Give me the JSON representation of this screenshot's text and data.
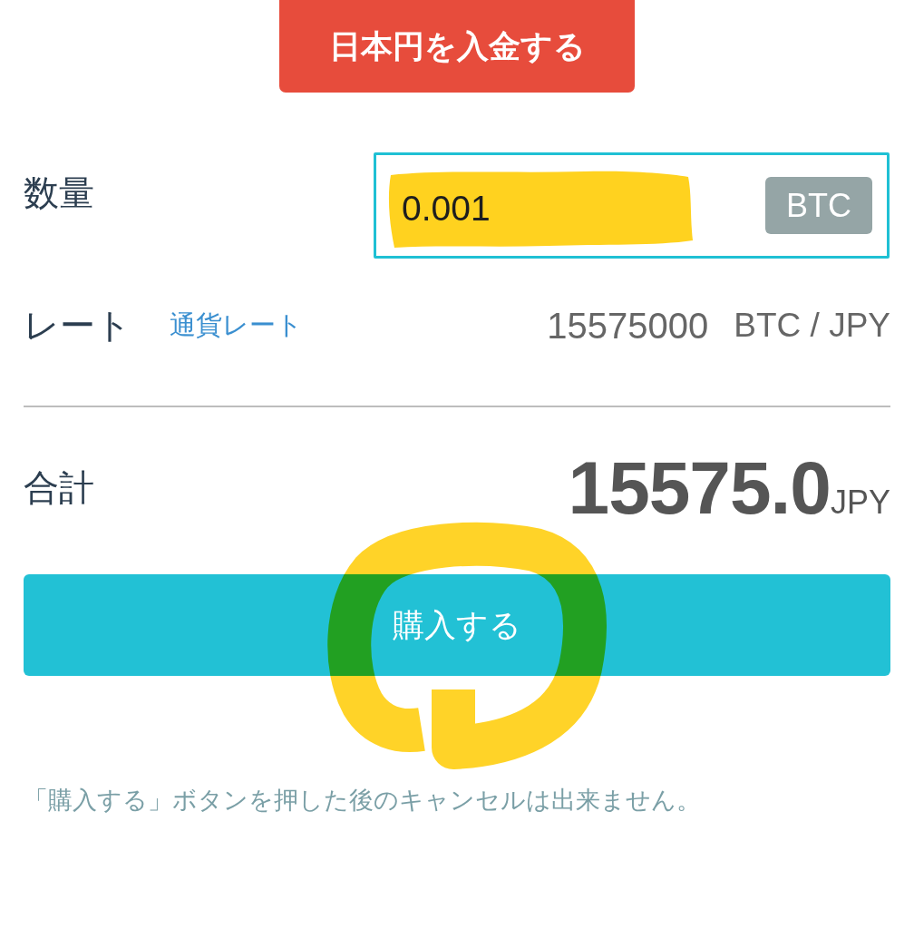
{
  "deposit_button": {
    "label": "日本円を入金する"
  },
  "quantity": {
    "label": "数量",
    "value": "0.001",
    "unit": "BTC"
  },
  "rate": {
    "label": "レート",
    "link": "通貨レート",
    "value": "15575000",
    "pair": "BTC / JPY"
  },
  "total": {
    "label": "合計",
    "amount": "15575.0",
    "currency": "JPY"
  },
  "purchase_button": {
    "label": "購入する"
  },
  "notice": "「購入する」ボタンを押した後のキャンセルは出来ません。"
}
